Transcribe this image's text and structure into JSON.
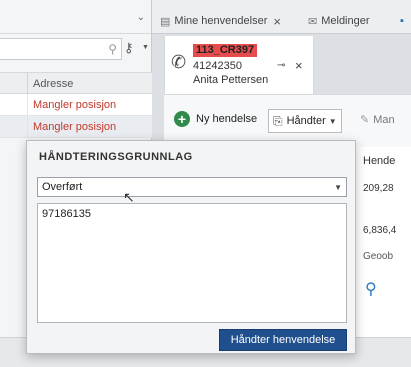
{
  "left_pane": {
    "column_header": "Adresse",
    "rows": [
      {
        "text": "Mangler posisjon"
      },
      {
        "text": "Mangler posisjon"
      }
    ],
    "search_icon": "search-icon",
    "key_icon": "key-icon"
  },
  "tabs": [
    {
      "label": "Mine henvendelser",
      "icon": "list-icon"
    },
    {
      "label": "Meldinger",
      "icon": "mail-icon"
    }
  ],
  "call": {
    "case_id": "113_CR397",
    "phone": "41242350",
    "name": "Anita Pettersen",
    "case_color": "#e74c4c"
  },
  "toolbar": {
    "new_label": "Ny hendelse",
    "handle_label": "Håndter",
    "man_label": "Man"
  },
  "side": {
    "label": "Hende",
    "val1": "209,28",
    "val2": "6,836,4",
    "geo": "Geoob"
  },
  "dialog": {
    "title": "Håndteringsgrunnlag",
    "select_value": "Overført",
    "text_value": "97186135",
    "button_label": "Håndter henvendelse",
    "button_color": "#1f4f8c"
  }
}
